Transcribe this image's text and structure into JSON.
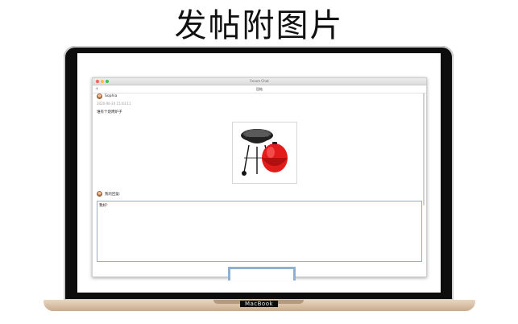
{
  "headline": "发帖附图片",
  "laptop": {
    "brand": "MacBook"
  },
  "window": {
    "title": "Forum Chat",
    "back_label": "‹",
    "nav_title": "回帖"
  },
  "post": {
    "author": "Sophia",
    "timestamp": "2020-06-24 15:03:11",
    "content": "谁有个烧烤炉子"
  },
  "reply": {
    "label": "我的回复:",
    "input_value": "我好!"
  },
  "colors": {
    "focus_border": "#8fb0cf",
    "grill_red": "#e31b1b"
  }
}
